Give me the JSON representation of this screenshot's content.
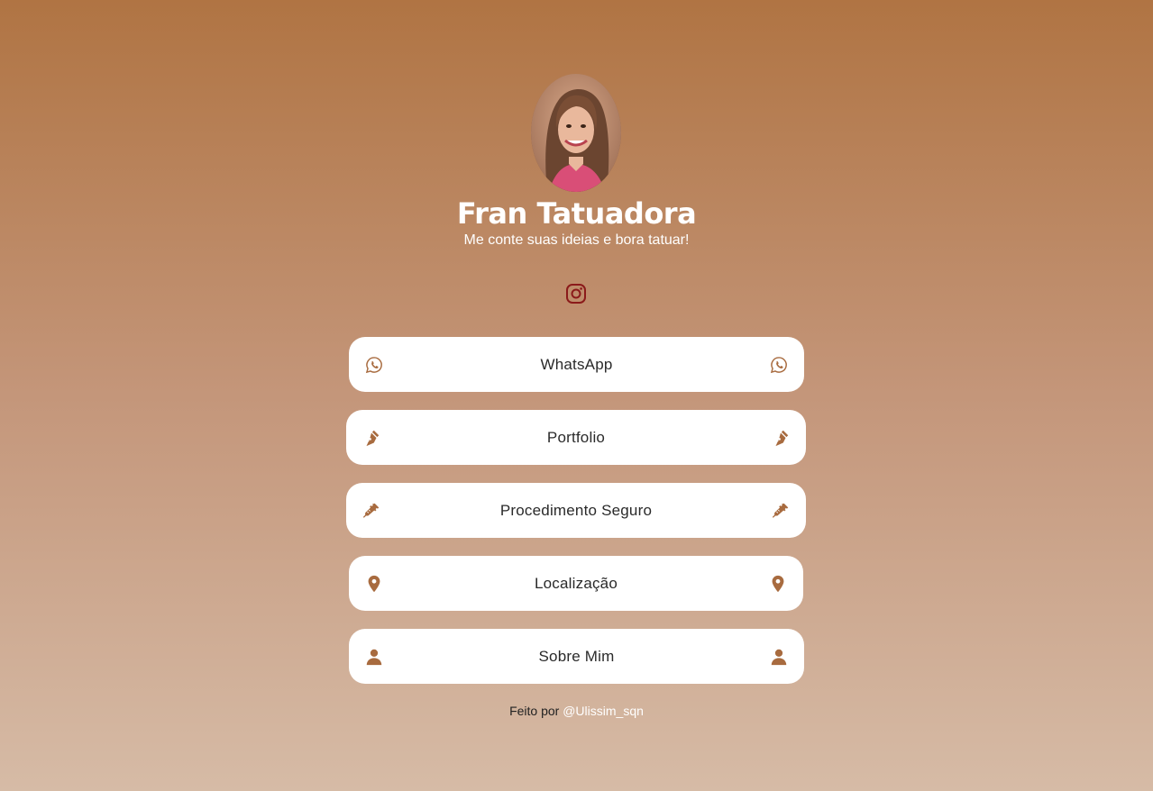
{
  "profile": {
    "name": "Fran Tatuadora",
    "tagline": "Me conte suas ideias e bora tatuar!",
    "avatar_alt": "profile-photo"
  },
  "social": {
    "instagram_icon": "instagram-icon"
  },
  "links": [
    {
      "label": "WhatsApp",
      "icon": "whatsapp-icon"
    },
    {
      "label": "Portfolio",
      "icon": "pen-nib-icon"
    },
    {
      "label": "Procedimento Seguro",
      "icon": "syringe-icon"
    },
    {
      "label": "Localização",
      "icon": "map-pin-icon"
    },
    {
      "label": "Sobre Mim",
      "icon": "user-icon"
    }
  ],
  "footer": {
    "prefix": "Feito por",
    "handle": "@Ulissim_sqn"
  },
  "colors": {
    "background_top": "#b07443",
    "background_bottom": "#d6bba6",
    "icon_brown": "#a86b3f",
    "instagram_red": "#8b1a1a",
    "button_bg": "#ffffff"
  }
}
